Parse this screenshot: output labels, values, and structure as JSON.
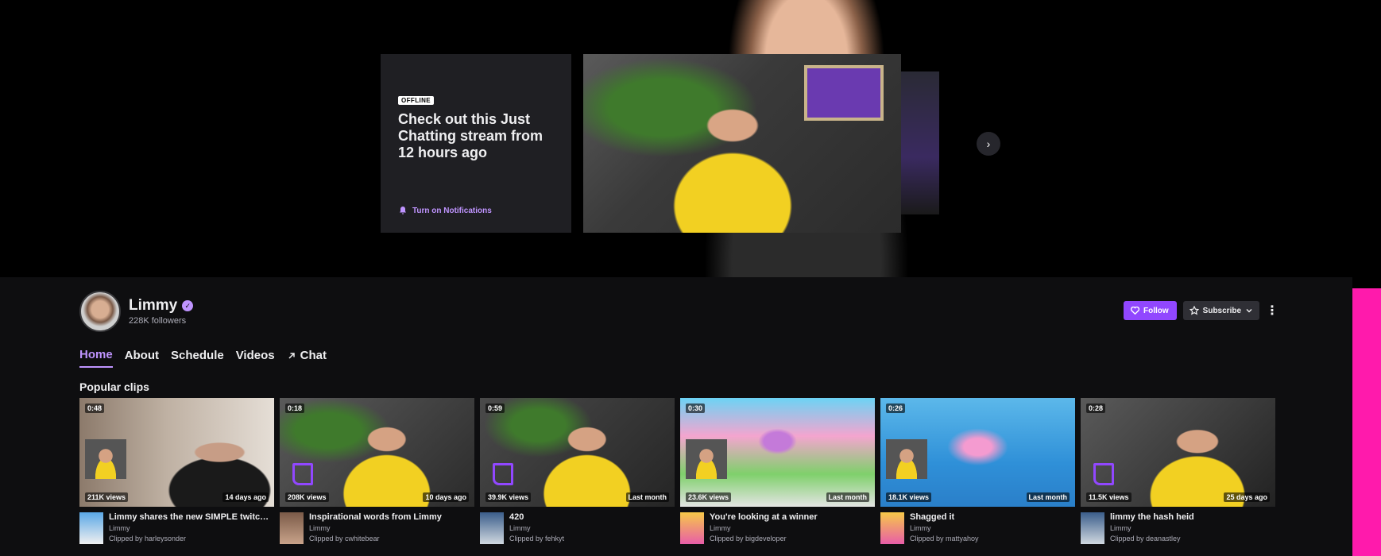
{
  "hero": {
    "offline_badge": "OFFLINE",
    "title": "Check out this Just Chatting stream from 12 hours ago",
    "notifications_label": "Turn on Notifications"
  },
  "channel": {
    "name": "Limmy",
    "followers": "228K followers",
    "follow_label": "Follow",
    "subscribe_label": "Subscribe"
  },
  "tabs": [
    {
      "label": "Home",
      "active": true
    },
    {
      "label": "About"
    },
    {
      "label": "Schedule"
    },
    {
      "label": "Videos"
    },
    {
      "label": "Chat"
    }
  ],
  "popular_clips": {
    "title": "Popular clips",
    "items": [
      {
        "duration": "0:48",
        "views": "211K views",
        "ago": "14 days ago",
        "title": "Limmy shares the new SIMPLE twitch BA...",
        "channel": "Limmy",
        "clipped_by": "Clipped by harleysonder"
      },
      {
        "duration": "0:18",
        "views": "208K views",
        "ago": "10 days ago",
        "title": "Inspirational words from Limmy",
        "channel": "Limmy",
        "clipped_by": "Clipped by cwhitebear"
      },
      {
        "duration": "0:59",
        "views": "39.9K views",
        "ago": "Last month",
        "title": "420",
        "channel": "Limmy",
        "clipped_by": "Clipped by fehkyt"
      },
      {
        "duration": "0:30",
        "views": "23.6K views",
        "ago": "Last month",
        "title": "You're looking at a winner",
        "channel": "Limmy",
        "clipped_by": "Clipped by bigdeveloper"
      },
      {
        "duration": "0:26",
        "views": "18.1K views",
        "ago": "Last month",
        "title": "Shagged it",
        "channel": "Limmy",
        "clipped_by": "Clipped by mattyahoy"
      },
      {
        "duration": "0:28",
        "views": "11.5K views",
        "ago": "25 days ago",
        "title": "limmy the hash heid",
        "channel": "Limmy",
        "clipped_by": "Clipped by deanastley"
      }
    ]
  },
  "colors": {
    "accent": "#9147ff",
    "accent_light": "#bf94ff",
    "background": "#0e0e10",
    "side_strip": "#ff1aac"
  }
}
